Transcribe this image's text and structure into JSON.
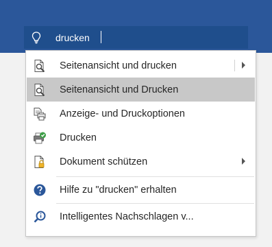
{
  "search": {
    "value": "drucken"
  },
  "menu": {
    "items": [
      {
        "label": "Seitenansicht und drucken",
        "icon": "print-preview-icon",
        "submenu": true,
        "split": true
      },
      {
        "label": "Seitenansicht und Drucken",
        "icon": "print-preview-icon",
        "selected": true
      },
      {
        "label": "Anzeige- und Druckoptionen",
        "icon": "display-print-options-icon"
      },
      {
        "label": "Drucken",
        "icon": "printer-check-icon"
      },
      {
        "label": "Dokument schützen",
        "icon": "lock-document-icon",
        "submenu": true
      },
      {
        "label": "Hilfe zu \"drucken\" erhalten",
        "icon": "help-icon"
      },
      {
        "label": "Intelligentes Nachschlagen v...",
        "icon": "smart-lookup-icon"
      }
    ]
  },
  "colors": {
    "ribbon": "#2b579a",
    "search_bg": "#1f4e8c",
    "selected_bg": "#c8c8c8",
    "accent_blue": "#2b579a"
  }
}
